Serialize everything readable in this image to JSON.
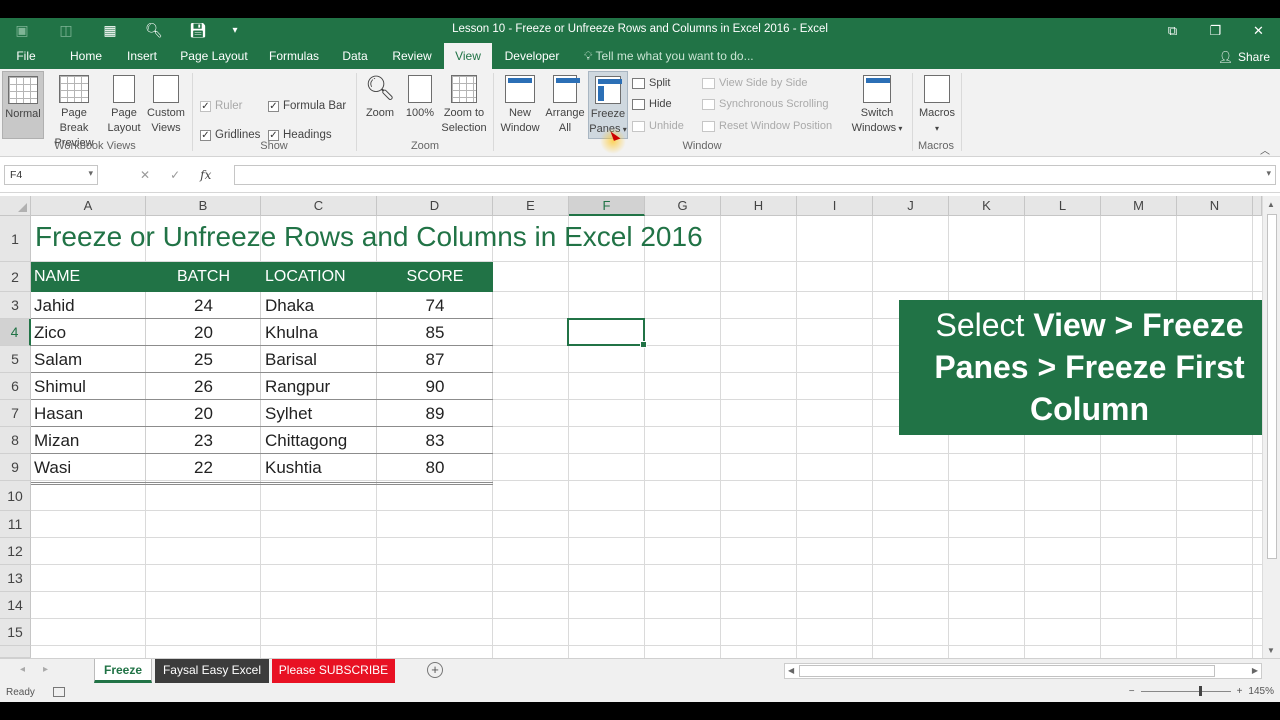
{
  "window": {
    "title": "Lesson 10 - Freeze or Unfreeze Rows and Columns in Excel 2016 - Excel",
    "controls": [
      "⧉",
      "❐",
      "✕"
    ]
  },
  "tabs": [
    {
      "label": "File",
      "active": false
    },
    {
      "label": "Home",
      "active": false
    },
    {
      "label": "Insert",
      "active": false
    },
    {
      "label": "Page Layout",
      "active": false
    },
    {
      "label": "Formulas",
      "active": false
    },
    {
      "label": "Data",
      "active": false
    },
    {
      "label": "Review",
      "active": false
    },
    {
      "label": "View",
      "active": true
    },
    {
      "label": "Developer",
      "active": false
    }
  ],
  "tell_me": "Tell me what you want to do...",
  "share": "Share",
  "ribbon": {
    "workbook_views": {
      "group_label": "Workbook Views",
      "normal": "Normal",
      "page_break_1": "Page Break",
      "page_break_2": "Preview",
      "page_layout_1": "Page",
      "page_layout_2": "Layout",
      "custom_1": "Custom",
      "custom_2": "Views"
    },
    "show": {
      "group_label": "Show",
      "ruler": "Ruler",
      "gridlines": "Gridlines",
      "formula_bar": "Formula Bar",
      "headings": "Headings"
    },
    "zoom": {
      "group_label": "Zoom",
      "zoom": "Zoom",
      "hundred": "100%",
      "zts_1": "Zoom to",
      "zts_2": "Selection"
    },
    "window": {
      "group_label": "Window",
      "new_1": "New",
      "new_2": "Window",
      "arrange_1": "Arrange",
      "arrange_2": "All",
      "freeze_1": "Freeze",
      "freeze_2": "Panes",
      "split": "Split",
      "hide": "Hide",
      "unhide": "Unhide",
      "side_by_side": "View Side by Side",
      "sync_scroll": "Synchronous Scrolling",
      "reset_pos": "Reset Window Position",
      "switch_1": "Switch",
      "switch_2": "Windows"
    },
    "macros": {
      "group_label": "Macros",
      "label": "Macros"
    }
  },
  "formula_bar": {
    "name_box": "F4",
    "formula": ""
  },
  "columns": [
    "A",
    "B",
    "C",
    "D",
    "E",
    "F",
    "G",
    "H",
    "I",
    "J",
    "K",
    "L",
    "M",
    "N"
  ],
  "selected_column": "F",
  "rows": [
    "1",
    "2",
    "3",
    "4",
    "5",
    "6",
    "7",
    "8",
    "9",
    "10",
    "11",
    "12",
    "13",
    "14",
    "15"
  ],
  "selected_row": "4",
  "sheet": {
    "title": "Freeze or Unfreeze Rows and Columns in Excel 2016",
    "headers": [
      "NAME",
      "BATCH",
      "LOCATION",
      "SCORE"
    ],
    "records": [
      {
        "name": "Jahid",
        "batch": "24",
        "location": "Dhaka",
        "score": "74"
      },
      {
        "name": "Zico",
        "batch": "20",
        "location": "Khulna",
        "score": "85"
      },
      {
        "name": "Salam",
        "batch": "25",
        "location": "Barisal",
        "score": "87"
      },
      {
        "name": "Shimul",
        "batch": "26",
        "location": "Rangpur",
        "score": "90"
      },
      {
        "name": "Hasan",
        "batch": "20",
        "location": "Sylhet",
        "score": "89"
      },
      {
        "name": "Mizan",
        "batch": "23",
        "location": "Chittagong",
        "score": "83"
      },
      {
        "name": "Wasi",
        "batch": "22",
        "location": "Kushtia",
        "score": "80"
      }
    ]
  },
  "callout": {
    "select": "Select",
    "view": "View",
    "gt1": ">",
    "freeze": "Freeze",
    "panes": "Panes",
    "gt2": ">",
    "freeze_first": "Freeze First",
    "column": "Column"
  },
  "sheet_tabs": [
    "Freeze",
    "Faysal Easy Excel",
    "Please SUBSCRIBE"
  ],
  "status": {
    "ready": "Ready",
    "zoom": "145%"
  },
  "colors": {
    "excel_green": "#217346",
    "subscribe_red": "#e81123",
    "faysal_dark": "#3c3c3c"
  }
}
